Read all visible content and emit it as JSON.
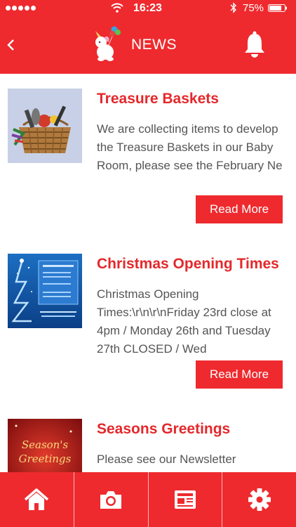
{
  "status_bar": {
    "time": "16:23",
    "battery": "75%"
  },
  "header": {
    "title": "NEWS"
  },
  "news": [
    {
      "title": "Treasure Baskets",
      "excerpt": "We are collecting items to develop the Treasure Baskets in our Baby Room, please see the February Ne",
      "button": "Read More"
    },
    {
      "title": "Christmas Opening Times",
      "excerpt": "Christmas Opening Times:\\r\\n\\r\\nFriday 23rd close at 4pm / Monday 26th and Tuesday 27th CLOSED / Wed",
      "button": "Read More"
    },
    {
      "title": "Seasons Greetings",
      "excerpt": "Please see our Newsletter"
    }
  ],
  "thumb_text": {
    "greetings_line1": "Season's",
    "greetings_line2": "Greetings"
  },
  "tabs": [
    {
      "icon": "home-icon"
    },
    {
      "icon": "camera-icon"
    },
    {
      "icon": "newspaper-icon"
    },
    {
      "icon": "gear-icon"
    }
  ],
  "colors": {
    "primary": "#ee2a2e",
    "title_text": "#e4282b",
    "body_text": "#555555"
  }
}
